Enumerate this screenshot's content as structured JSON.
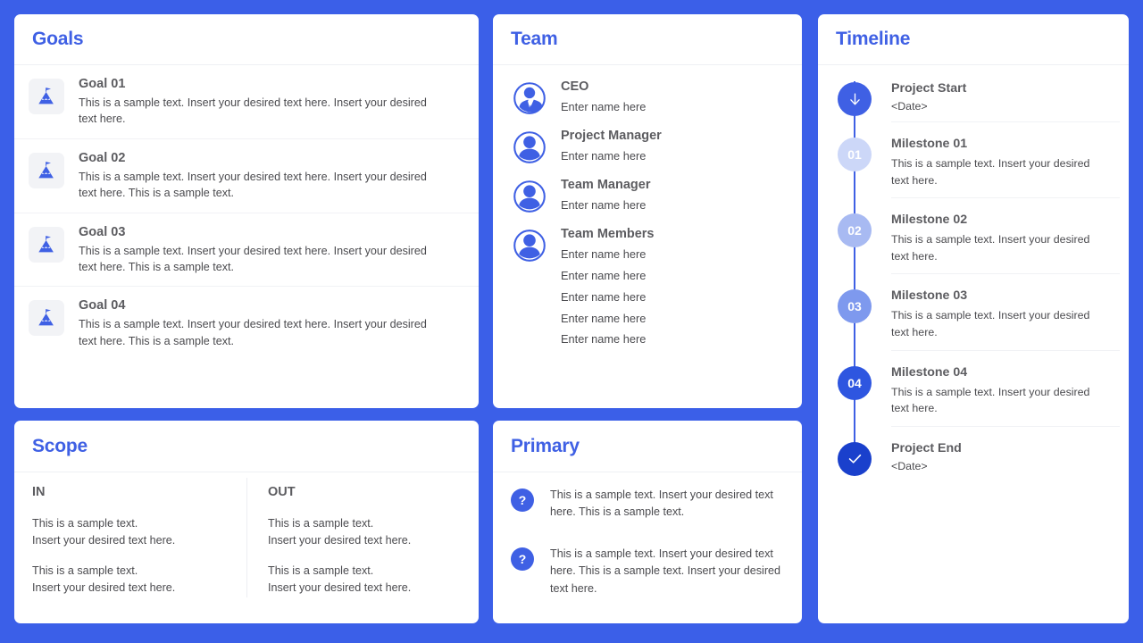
{
  "colors": {
    "background": "#3b5fe8",
    "accent": "#3f60e4",
    "card": "#ffffff",
    "title": "#3f60e4",
    "heading_text": "#5c5c60",
    "body_text": "#4b4b4f",
    "icon_tile": "#f2f3f6",
    "divider": "#f1f2f5"
  },
  "goals": {
    "title": "Goals",
    "items": [
      {
        "icon": "mountain-flag-icon",
        "label": "Goal 01",
        "description": "This is a sample text. Insert your desired text here. Insert your desired text here."
      },
      {
        "icon": "mountain-flag-icon",
        "label": "Goal 02",
        "description": "This is a sample text. Insert your desired text here. Insert your desired text here. This is a sample text."
      },
      {
        "icon": "mountain-flag-icon",
        "label": "Goal 03",
        "description": "This is a sample text. Insert your desired text here. Insert your desired text here. This is a sample text."
      },
      {
        "icon": "mountain-flag-icon",
        "label": "Goal 04",
        "description": "This is a sample text. Insert your desired text here. Insert your desired text here. This is a sample text."
      }
    ]
  },
  "team": {
    "title": "Team",
    "members": [
      {
        "icon": "person-suit-icon",
        "role": "CEO",
        "names": [
          "Enter name here"
        ]
      },
      {
        "icon": "person-icon",
        "role": "Project Manager",
        "names": [
          "Enter name here"
        ]
      },
      {
        "icon": "person-icon",
        "role": "Team Manager",
        "names": [
          "Enter name here"
        ]
      },
      {
        "icon": "person-icon",
        "role": "Team Members",
        "names": [
          "Enter name here",
          "Enter name here",
          "Enter name here",
          "Enter name here",
          "Enter name here"
        ]
      }
    ]
  },
  "timeline": {
    "title": "Timeline",
    "items": [
      {
        "marker": "arrow-down-icon",
        "marker_type": "icon",
        "bubble_color": "#3f60e4",
        "label": "Project Start",
        "description": "<Date>"
      },
      {
        "marker": "01",
        "marker_type": "number",
        "bubble_color": "#ccd7f8",
        "label": "Milestone 01",
        "description": "This is a sample text. Insert your desired text here."
      },
      {
        "marker": "02",
        "marker_type": "number",
        "bubble_color": "#a8baf2",
        "label": "Milestone 02",
        "description": "This is a sample text. Insert your desired text here."
      },
      {
        "marker": "03",
        "marker_type": "number",
        "bubble_color": "#7e99ee",
        "label": "Milestone 03",
        "description": "This is a sample text. Insert your desired text here."
      },
      {
        "marker": "04",
        "marker_type": "number",
        "bubble_color": "#2e56e0",
        "label": "Milestone 04",
        "description": "This is a sample text. Insert your desired text here."
      },
      {
        "marker": "check-icon",
        "marker_type": "icon",
        "bubble_color": "#1a40cc",
        "label": "Project End",
        "description": "<Date>"
      }
    ]
  },
  "scope": {
    "title": "Scope",
    "columns": [
      {
        "heading": "IN",
        "items": [
          "This is a sample text.\nInsert your desired text here.",
          "This is a sample text.\nInsert your desired text here."
        ]
      },
      {
        "heading": "OUT",
        "items": [
          "This is a sample text.\nInsert your desired text here.",
          "This is a sample text.\nInsert your desired text here."
        ]
      }
    ]
  },
  "primary": {
    "title": "Primary",
    "items": [
      {
        "badge": "?",
        "text": "This is a sample text. Insert your desired text here. This is a sample text."
      },
      {
        "badge": "?",
        "text": "This is a sample text. Insert your desired text here. This is a sample text. Insert your desired text here."
      }
    ]
  }
}
